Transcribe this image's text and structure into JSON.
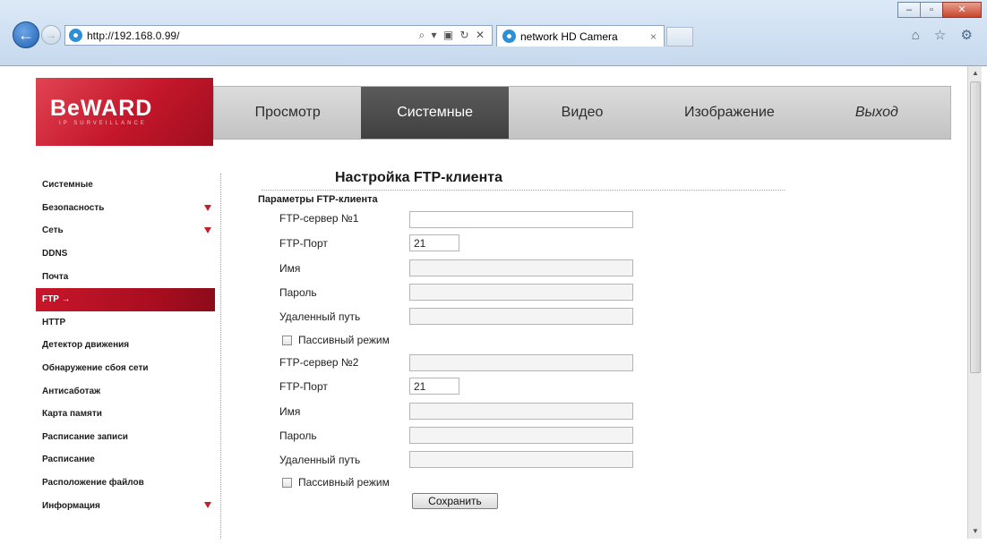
{
  "browser": {
    "url": "http://192.168.0.99/",
    "address_tools": "⌕ ▾ ▣ ↻ ✕",
    "tab_title": "network HD Camera",
    "tab_close": "×",
    "controls": {
      "minimize": "–",
      "maximize": "▫",
      "close": "✕"
    },
    "back": "←",
    "forward": "→",
    "right_icons": "⌂ ☆ ⚙",
    "scroll_up": "▲",
    "scroll_down": "▼"
  },
  "brand": {
    "name": "BeWARD",
    "tagline": "IP SURVEILLANCE"
  },
  "menu": {
    "items": [
      {
        "label": "Просмотр"
      },
      {
        "label": "Системные"
      },
      {
        "label": "Видео"
      },
      {
        "label": "Изображение"
      },
      {
        "label": "Выход"
      }
    ],
    "active": "Системные"
  },
  "sidebar": {
    "items": [
      {
        "label": "Системные"
      },
      {
        "label": "Безопасность"
      },
      {
        "label": "Сеть"
      },
      {
        "label": "DDNS"
      },
      {
        "label": "Почта"
      },
      {
        "label": "FTP →"
      },
      {
        "label": "HTTP"
      },
      {
        "label": "Детектор движения"
      },
      {
        "label": "Обнаружение сбоя сети"
      },
      {
        "label": "Антисаботаж"
      },
      {
        "label": "Карта памяти"
      },
      {
        "label": "Расписание записи"
      },
      {
        "label": "Расписание"
      },
      {
        "label": "Расположение файлов"
      },
      {
        "label": "Информация"
      }
    ],
    "active": "FTP →"
  },
  "page": {
    "title": "Настройка FTP-клиента",
    "section": "Параметры FTP-клиента",
    "server1": {
      "server_label": "FTP-сервер №1",
      "server_value": "",
      "port_label": "FTP-Порт",
      "port_value": "21",
      "user_label": "Имя",
      "user_value": "",
      "password_label": "Пароль",
      "password_value": "",
      "path_label": "Удаленный путь",
      "path_value": "",
      "passive_label": "Пассивный режим",
      "passive_checked": false
    },
    "server2": {
      "server_label": "FTP-сервер №2",
      "server_value": "",
      "port_label": "FTP-Порт",
      "port_value": "21",
      "user_label": "Имя",
      "user_value": "",
      "password_label": "Пароль",
      "password_value": "",
      "path_label": "Удаленный путь",
      "path_value": "",
      "passive_label": "Пассивный режим",
      "passive_checked": false
    },
    "save_label": "Сохранить"
  }
}
